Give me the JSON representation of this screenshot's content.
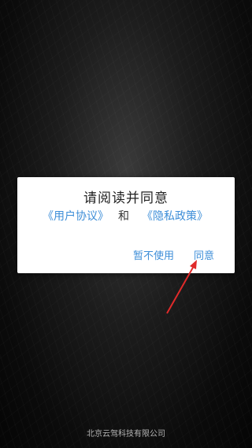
{
  "dialog": {
    "title": "请阅读并同意",
    "user_agreement_link": "《用户协议》",
    "and_text": "和",
    "privacy_policy_link": "《隐私政策》",
    "decline_button": "暂不使用",
    "agree_button": "同意"
  },
  "footer": {
    "company": "北京云驾科技有限公司"
  },
  "colors": {
    "link": "#3d8ed8",
    "annotation_arrow": "#e02a2a"
  }
}
